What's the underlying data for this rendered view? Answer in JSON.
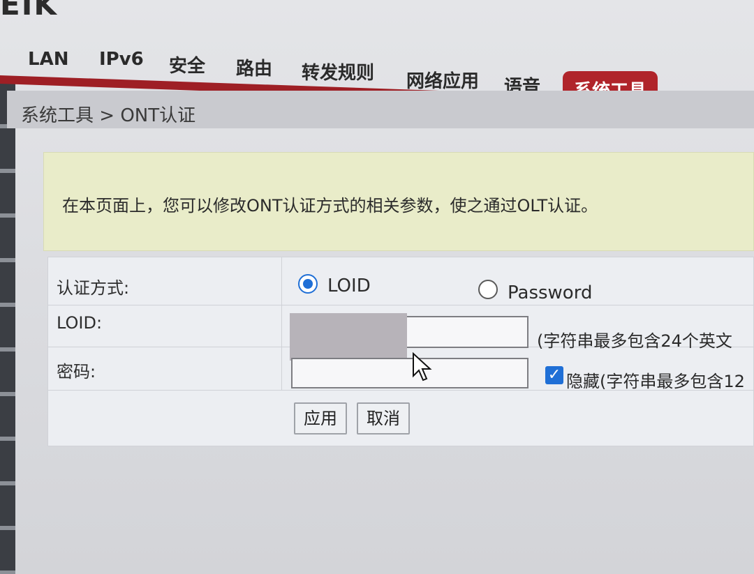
{
  "brand": "EIK",
  "nav": {
    "items": [
      "LAN",
      "IPv6",
      "安全",
      "路由",
      "转发规则",
      "网络应用",
      "语音"
    ],
    "active": "系统工具"
  },
  "breadcrumb": "系统工具 > ONT认证",
  "notice": "在本页面上，您可以修改ONT认证方式的相关参数，使之通过OLT认证。",
  "form": {
    "auth_label": "认证方式:",
    "loid_option": "LOID",
    "password_option": "Password",
    "loid_label": "LOID:",
    "loid_hint": "(字符串最多包含24个英文",
    "password_label": "密码:",
    "hide_label": "隐藏(字符串最多包含12",
    "apply_button": "应用",
    "cancel_button": "取消"
  },
  "colors": {
    "accent": "#b0242a",
    "notice_bg": "#e9ecc9",
    "radio_checked": "#1f6fd6"
  }
}
